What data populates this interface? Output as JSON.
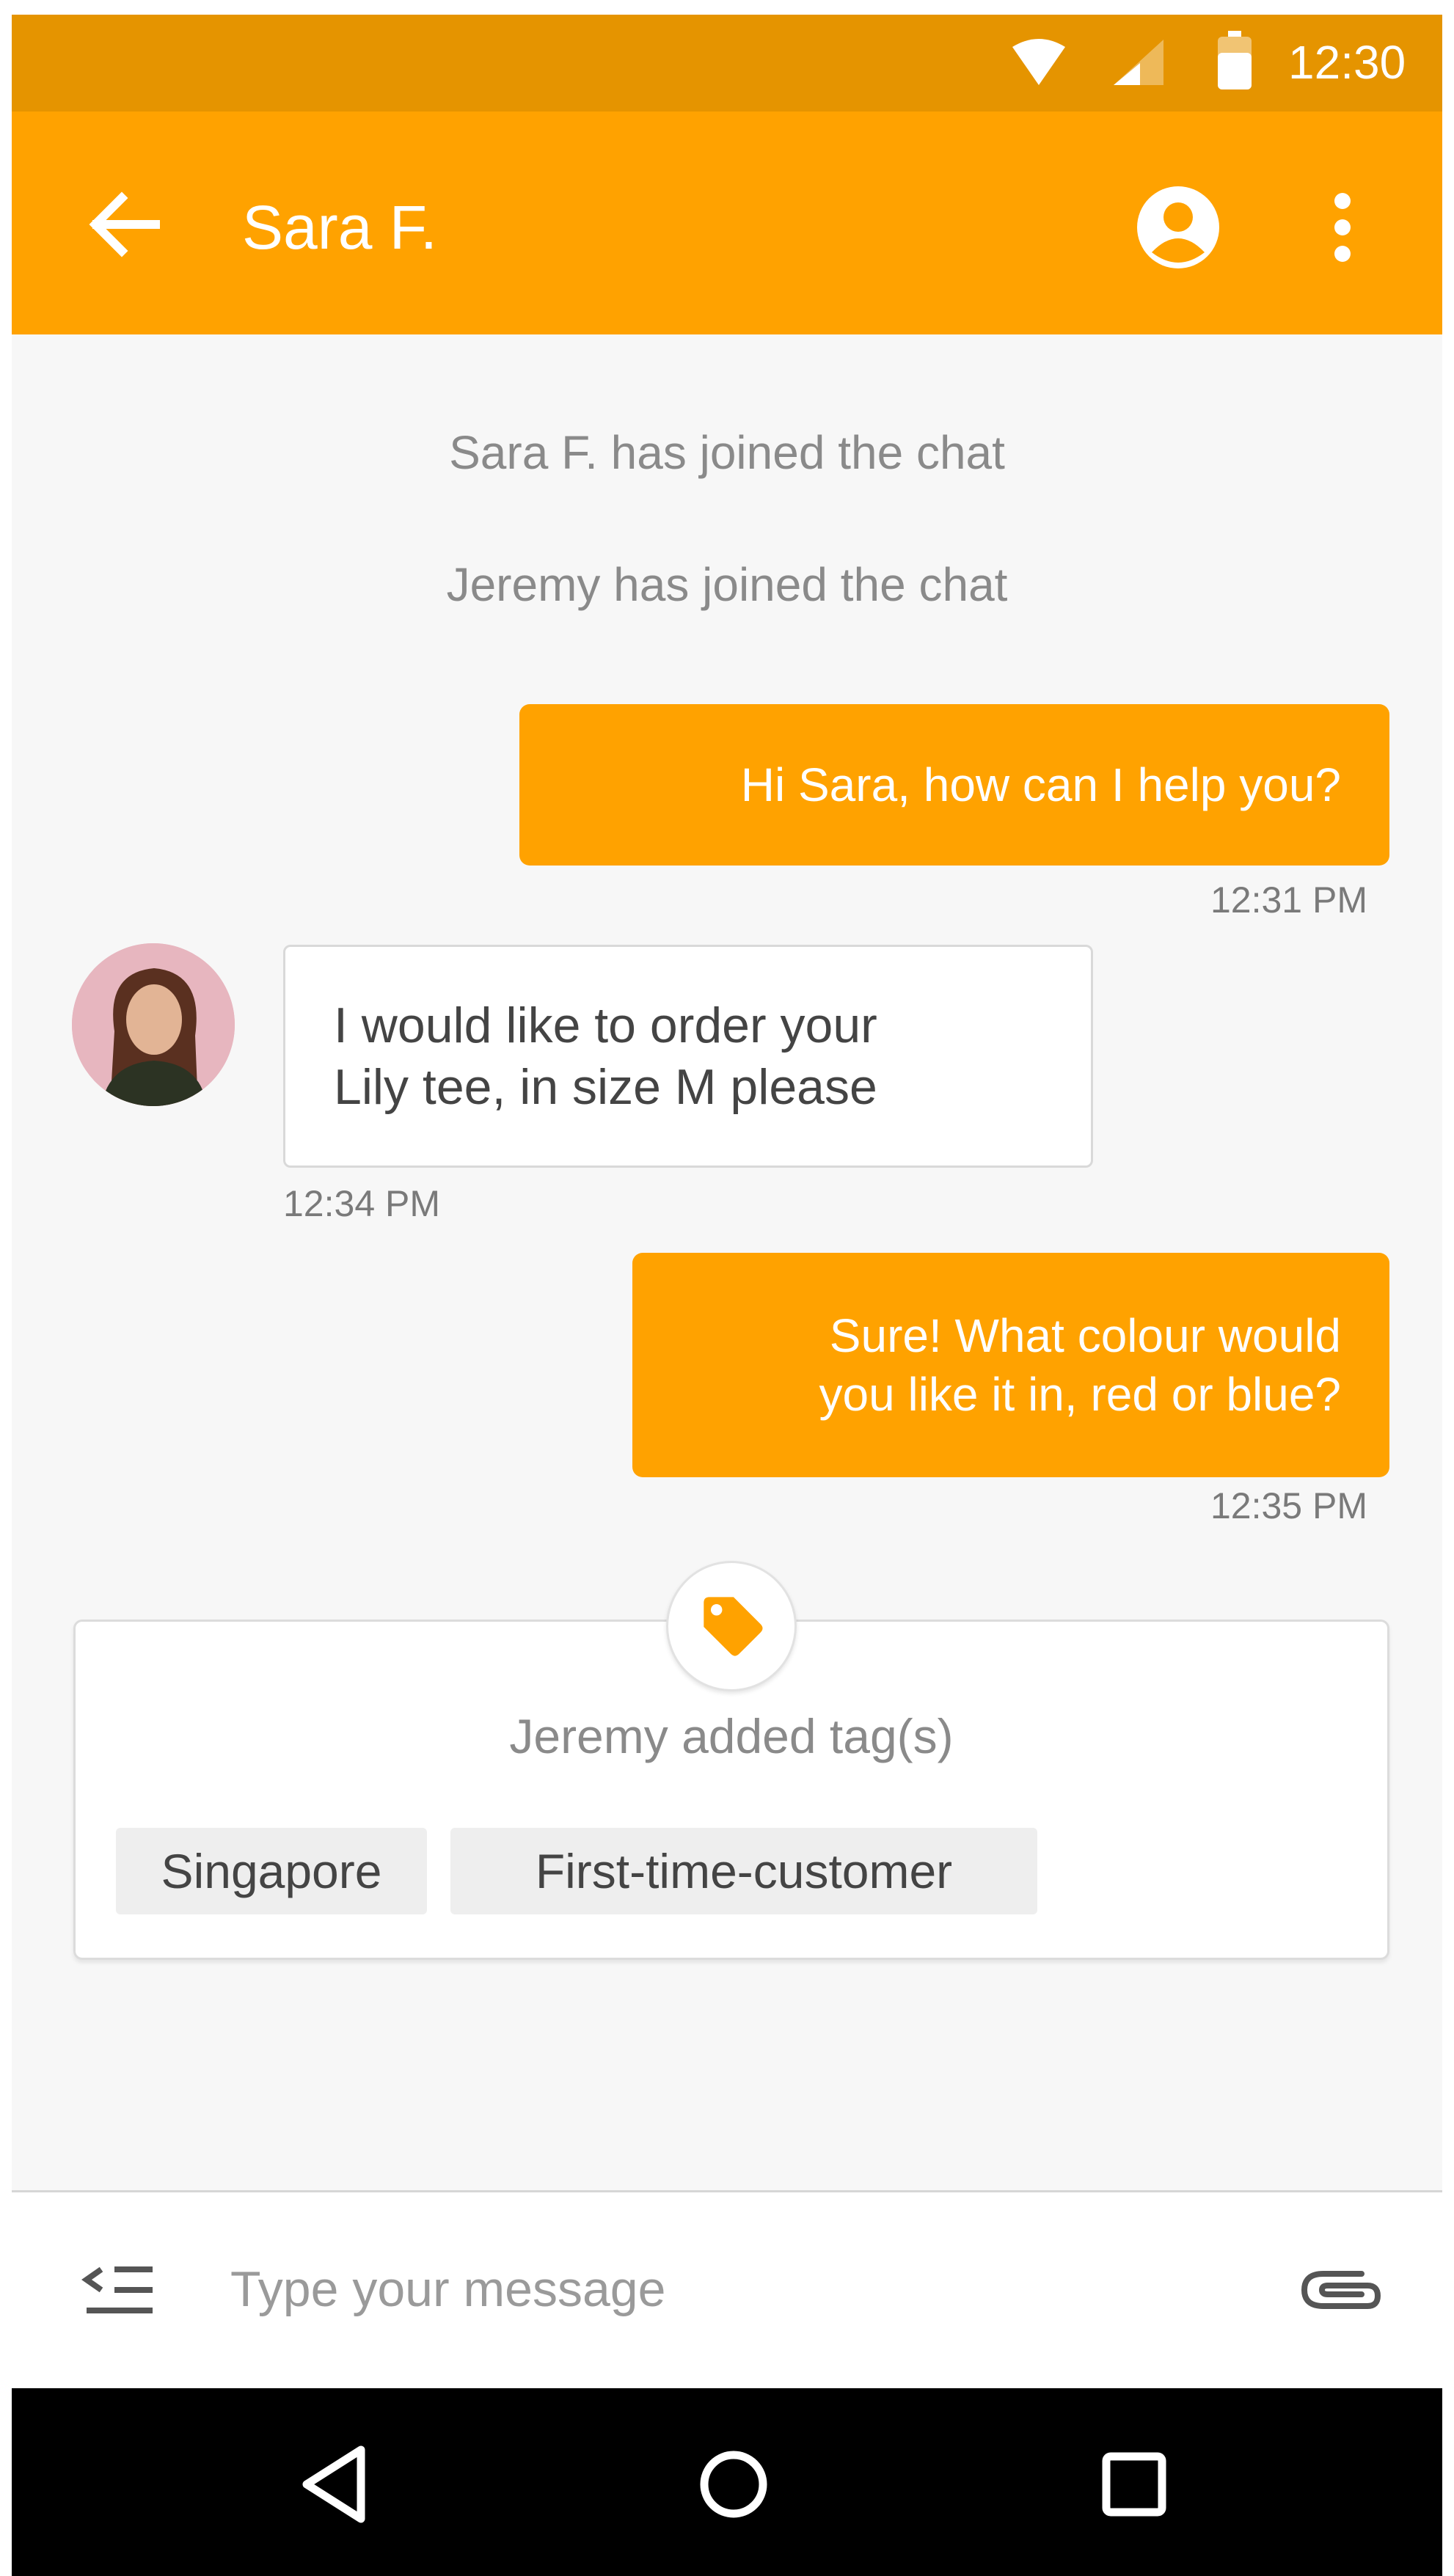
{
  "status_bar": {
    "time": "12:30",
    "icons": [
      "wifi-icon",
      "cell-signal-icon",
      "battery-icon"
    ]
  },
  "app_bar": {
    "title": "Sara F.",
    "icons": [
      "back-arrow-icon",
      "account-circle-icon",
      "more-vert-icon"
    ]
  },
  "conversation": {
    "system_messages": [
      "Sara F. has joined the chat",
      "Jeremy has joined the chat"
    ],
    "messages": [
      {
        "sender": "agent",
        "lines": [
          "Hi Sara, how can I help you?"
        ],
        "time": "12:31 PM"
      },
      {
        "sender": "customer",
        "lines": [
          "I would like to order your",
          "Lily tee, in size M please"
        ],
        "time": "12:34 PM"
      },
      {
        "sender": "agent",
        "lines": [
          "Sure! What colour would",
          "you like it in, red or blue?"
        ],
        "time": "12:35 PM"
      }
    ]
  },
  "tag_card": {
    "icon": "tag-icon",
    "title": "Jeremy added tag(s)",
    "tags": [
      "Singapore",
      "First-time-customer"
    ]
  },
  "input_bar": {
    "placeholder": "Type your message",
    "value": "",
    "icons": [
      "quick-replies-icon",
      "paperclip-icon"
    ]
  },
  "nav_bar": {
    "icons": [
      "nav-back-icon",
      "nav-home-icon",
      "nav-recents-icon"
    ]
  },
  "colors": {
    "status_bar": "#e59400",
    "accent": "#ffa200",
    "chat_background": "#f7f7f7",
    "nav_bar": "#000000"
  }
}
